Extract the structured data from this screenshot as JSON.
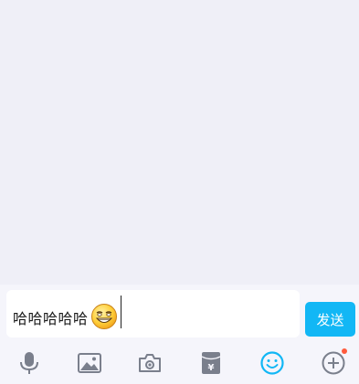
{
  "composer": {
    "input_text": "哈哈哈哈哈",
    "inline_emoji": "grinning-face-emoji",
    "send_label": "发送"
  },
  "toolbar": {
    "items": [
      {
        "icon": "microphone-icon"
      },
      {
        "icon": "image-icon"
      },
      {
        "icon": "camera-icon"
      },
      {
        "icon": "red-packet-icon"
      },
      {
        "icon": "emoji-icon",
        "active": true
      },
      {
        "icon": "plus-icon",
        "badge": "dot"
      }
    ]
  },
  "colors": {
    "background": "#efeff7",
    "accent": "#12b7f5",
    "icon_gray": "#7a7f8c",
    "badge": "#ff5a3c"
  }
}
